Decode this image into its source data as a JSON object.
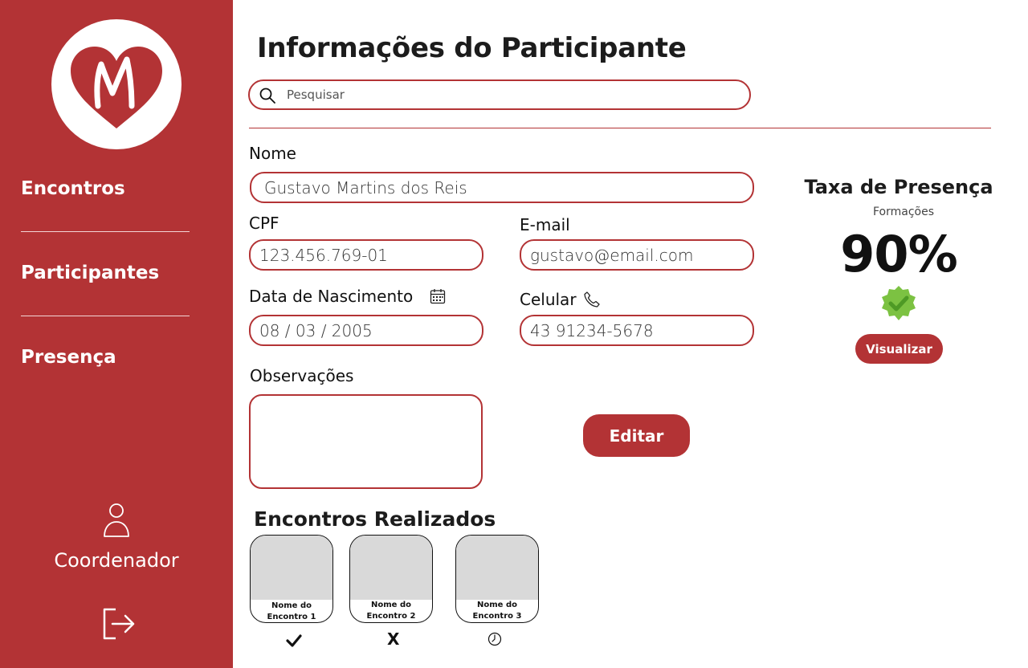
{
  "sidebar": {
    "logo_letter": "M",
    "items": [
      {
        "label": "Encontros"
      },
      {
        "label": "Participantes"
      },
      {
        "label": "Presença"
      }
    ],
    "user_label": "Coordenador",
    "colors": {
      "background": "#b33335",
      "text": "#ffffff"
    }
  },
  "main": {
    "title": "Informações do Participante",
    "search": {
      "placeholder": "Pesquisar"
    },
    "form": {
      "nome": {
        "label": "Nome",
        "value": "Gustavo Martins dos Reis"
      },
      "cpf": {
        "label": "CPF",
        "value": "123.456.769-01"
      },
      "email": {
        "label": "E-mail",
        "value": "gustavo@email.com"
      },
      "nascimento": {
        "label": "Data de Nascimento",
        "value": "08 / 03 / 2005"
      },
      "celular": {
        "label": "Celular",
        "value": "43 91234-5678"
      },
      "observacoes": {
        "label": "Observações",
        "value": ""
      }
    },
    "edit_label": "Editar"
  },
  "presence": {
    "title": "Taxa de Presença",
    "subtitle": "Formações",
    "value": "90%",
    "badge_color": "#7cc242",
    "view_label": "Visualizar"
  },
  "encontros": {
    "title": "Encontros Realizados",
    "cards": [
      {
        "name_line1": "Nome do",
        "name_line2": "Encontro 1",
        "status": "check-icon"
      },
      {
        "name_line1": "Nome do",
        "name_line2": "Encontro 2",
        "status": "x-icon",
        "status_text": "X"
      },
      {
        "name_line1": "Nome do",
        "name_line2": "Encontro 3",
        "status": "clock-icon"
      }
    ]
  },
  "accent_color": "#b33335"
}
